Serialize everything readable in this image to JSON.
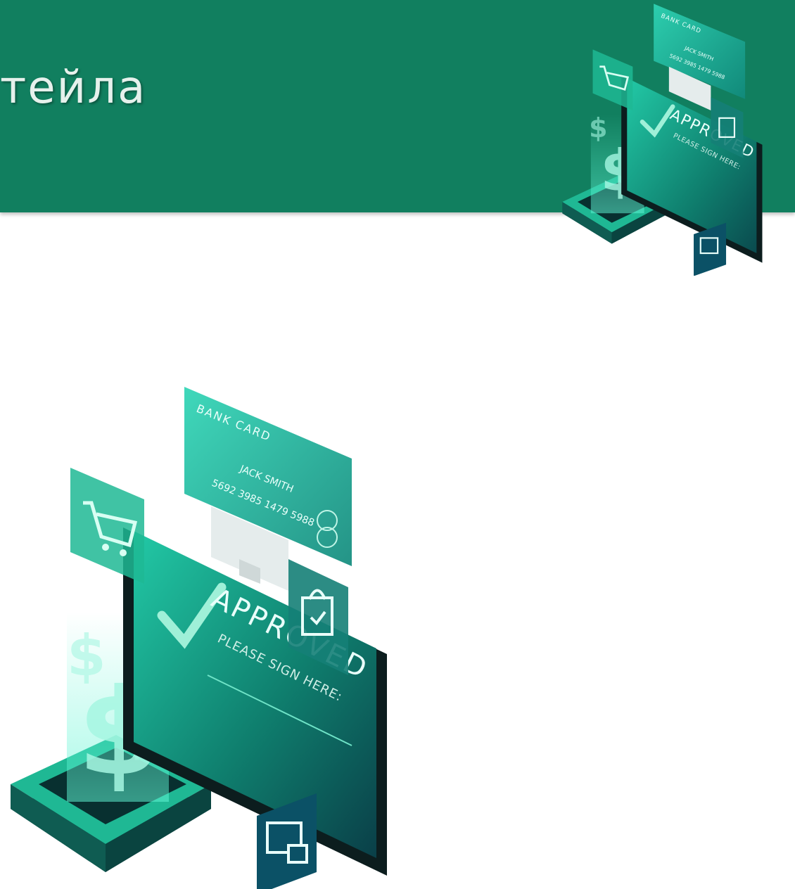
{
  "slide": {
    "title": "тейла"
  },
  "illustration": {
    "card_label": "BANK CARD",
    "card_holder": "JACK SMITH",
    "card_number": "5692 3985 1479 5988",
    "status_text": "APPROVED",
    "sign_prompt": "PLEASE SIGN HERE:"
  },
  "colors": {
    "banner": "#117f5f",
    "accent": "#1fd9b0",
    "dark": "#0b3b3b"
  }
}
